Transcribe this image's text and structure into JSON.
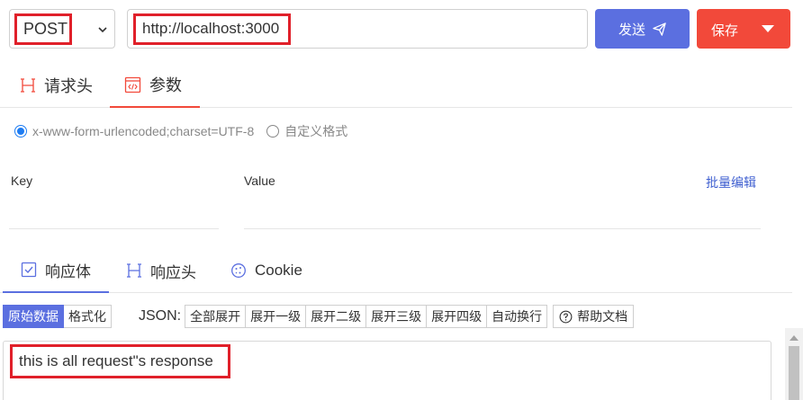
{
  "request": {
    "method": "POST",
    "url": "http://localhost:3000",
    "send_label": "发送",
    "save_label": "保存"
  },
  "request_tabs": [
    {
      "label": "请求头",
      "icon": "heading-icon",
      "active": false
    },
    {
      "label": "参数",
      "icon": "code-file-icon",
      "active": true
    }
  ],
  "params": {
    "encodings": [
      {
        "label": "x-www-form-urlencoded;charset=UTF-8",
        "checked": true
      },
      {
        "label": "自定义格式",
        "checked": false
      }
    ],
    "key_header": "Key",
    "value_header": "Value",
    "bulk_edit_label": "批量编辑"
  },
  "response_tabs": [
    {
      "label": "响应体",
      "icon": "checkbox-icon",
      "active": true
    },
    {
      "label": "响应头",
      "icon": "heading-icon",
      "active": false
    },
    {
      "label": "Cookie",
      "icon": "cookie-icon",
      "active": false
    }
  ],
  "response_toolbar": {
    "view_modes": [
      "原始数据",
      "格式化"
    ],
    "active_view": "原始数据",
    "json_label": "JSON:",
    "expand_options": [
      "全部展开",
      "展开一级",
      "展开二级",
      "展开三级",
      "展开四级",
      "自动换行"
    ],
    "help_label": "帮助文档"
  },
  "response_body": "this is all request\"s response",
  "colors": {
    "primary": "#5b6fe0",
    "danger": "#f2493a",
    "highlight": "#e0202a",
    "link": "#3f5fd0"
  }
}
